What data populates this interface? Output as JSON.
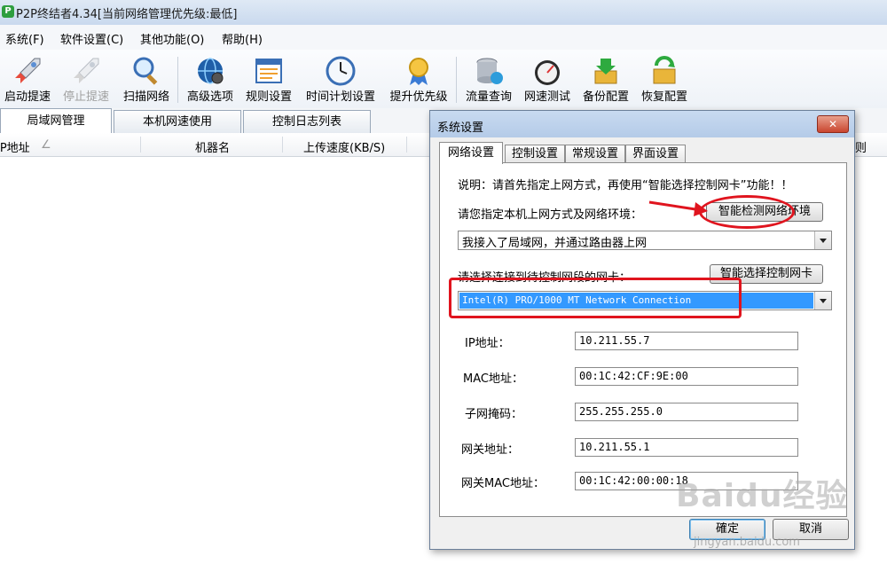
{
  "window": {
    "title": "P2P终结者4.34[当前网络管理优先级:最低]",
    "app_icon_glyph": "P"
  },
  "menu": [
    {
      "label": "系统(F)"
    },
    {
      "label": "软件设置(C)"
    },
    {
      "label": "其他功能(O)"
    },
    {
      "label": "帮助(H)"
    }
  ],
  "toolbar": [
    {
      "label": "启动提速",
      "icon": "rocket-icon",
      "enabled": true
    },
    {
      "label": "停止提速",
      "icon": "rocket-stop-icon",
      "enabled": false
    },
    {
      "label": "扫描网络",
      "icon": "magnifier-icon",
      "enabled": true
    },
    {
      "label": "高级选项",
      "icon": "globe-gear-icon",
      "enabled": true
    },
    {
      "label": "规则设置",
      "icon": "window-rules-icon",
      "enabled": true
    },
    {
      "label": "时间计划设置",
      "icon": "clock-icon",
      "enabled": true
    },
    {
      "label": "提升优先级",
      "icon": "medal-icon",
      "enabled": true
    },
    {
      "label": "流量查询",
      "icon": "database-globe-icon",
      "enabled": true
    },
    {
      "label": "网速测试",
      "icon": "speedometer-icon",
      "enabled": true
    },
    {
      "label": "备份配置",
      "icon": "box-down-arrow-icon",
      "enabled": true
    },
    {
      "label": "恢复配置",
      "icon": "box-refresh-icon",
      "enabled": true
    }
  ],
  "main_tabs": [
    {
      "label": "局域网管理",
      "active": true
    },
    {
      "label": "本机网速使用",
      "active": false
    },
    {
      "label": "控制日志列表",
      "active": false
    }
  ],
  "list_columns": [
    {
      "label": "IP地址"
    },
    {
      "label": "机器名"
    },
    {
      "label": "上传速度(KB/S)"
    },
    {
      "label": "则"
    }
  ],
  "dialog": {
    "title": "系统设置",
    "close_glyph": "✕",
    "tabs": [
      {
        "label": "网络设置",
        "active": true
      },
      {
        "label": "控制设置",
        "active": false
      },
      {
        "label": "常规设置",
        "active": false
      },
      {
        "label": "界面设置",
        "active": false
      }
    ],
    "note": "说明：请首先指定上网方式，再使用“智能选择控制网卡”功能！！",
    "env_label": "请您指定本机上网方式及网络环境：",
    "env_button": "智能检测网络环境",
    "env_value": "我接入了局域网，并通过路由器上网",
    "nic_label": "请选择连接到待控制网段的网卡：",
    "nic_button": "智能选择控制网卡",
    "nic_value": "Intel(R) PRO/1000 MT Network Connection",
    "fields": [
      {
        "label": "IP地址：",
        "value": "10.211.55.7"
      },
      {
        "label": "MAC地址：",
        "value": "00:1C:42:CF:9E:00"
      },
      {
        "label": "子网掩码：",
        "value": "255.255.255.0"
      },
      {
        "label": "网关地址：",
        "value": "10.211.55.1"
      },
      {
        "label": "网关MAC地址：",
        "value": "00:1C:42:00:00:18"
      }
    ],
    "ok_button": "確定",
    "cancel_button": "取消"
  },
  "watermark": {
    "text": "Baidu经验",
    "sub": "jingyan.baidu.com"
  },
  "colors": {
    "annotation_red": "#e0141e",
    "selection_blue": "#3399ff"
  }
}
